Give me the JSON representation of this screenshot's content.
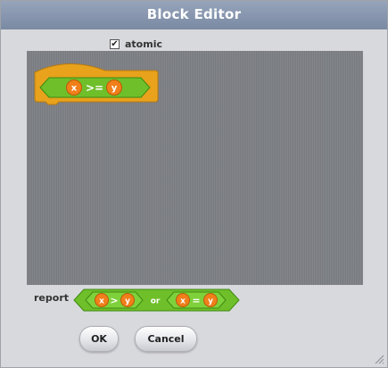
{
  "window": {
    "title": "Block Editor"
  },
  "options": {
    "atomic_label": "atomic",
    "atomic_checked": true,
    "check_mark": "✔"
  },
  "custom_block": {
    "left_arg": "x",
    "operator": ">=",
    "right_arg": "y"
  },
  "report": {
    "label": "report",
    "left_expr": {
      "left_arg": "x",
      "operator": ">",
      "right_arg": "y"
    },
    "joiner": "or",
    "right_expr": {
      "left_arg": "x",
      "operator": "=",
      "right_arg": "y"
    }
  },
  "buttons": {
    "ok_label": "OK",
    "cancel_label": "Cancel"
  },
  "colors": {
    "operator_green": "#6fbf2a",
    "variable_orange": "#f07f1a",
    "hat_orange": "#e8a21c",
    "editor_bg": "#7c7f84"
  },
  "icons": {
    "resize": "resize-grip-icon"
  }
}
